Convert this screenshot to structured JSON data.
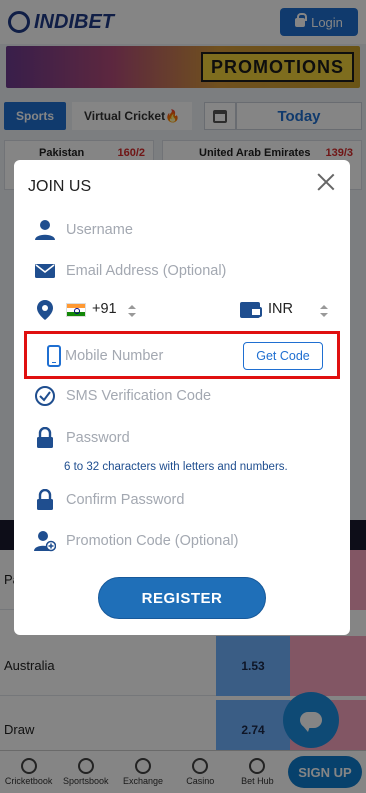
{
  "header": {
    "brand": "INDIBET",
    "login_label": "Login"
  },
  "promo": {
    "label": "PROMOTIONS"
  },
  "tabs": {
    "sports": "Sports",
    "virtual": "Virtual Cricket🔥",
    "today": "Today"
  },
  "matches": [
    {
      "team": "Pakistan",
      "score": "160/2"
    },
    {
      "team": "United Arab Emirates",
      "score": "139/3"
    }
  ],
  "odds": {
    "rows": [
      {
        "team": "Pakistan",
        "back": ""
      },
      {
        "team": "Australia",
        "back": "1.53"
      },
      {
        "team": "Draw",
        "back": "2.74"
      }
    ]
  },
  "bottom_nav": {
    "items": [
      "Cricketbook",
      "Sportsbook",
      "Exchange",
      "Casino",
      "Bet Hub"
    ],
    "signup_label": "SIGN UP"
  },
  "modal": {
    "title": "JOIN US",
    "username_placeholder": "Username",
    "email_placeholder": "Email Address (Optional)",
    "dial_code": "+91",
    "currency": "INR",
    "mobile_placeholder": "Mobile Number",
    "get_code_label": "Get Code",
    "sms_placeholder": "SMS Verification Code",
    "password_placeholder": "Password",
    "password_hint": "6 to 32 characters with letters and numbers.",
    "confirm_placeholder": "Confirm Password",
    "promo_placeholder": "Promotion Code (Optional)",
    "register_label": "REGISTER"
  },
  "colors": {
    "accent": "#1f6fd1",
    "highlight": "#e01010",
    "icon": "#1f4e8f"
  }
}
